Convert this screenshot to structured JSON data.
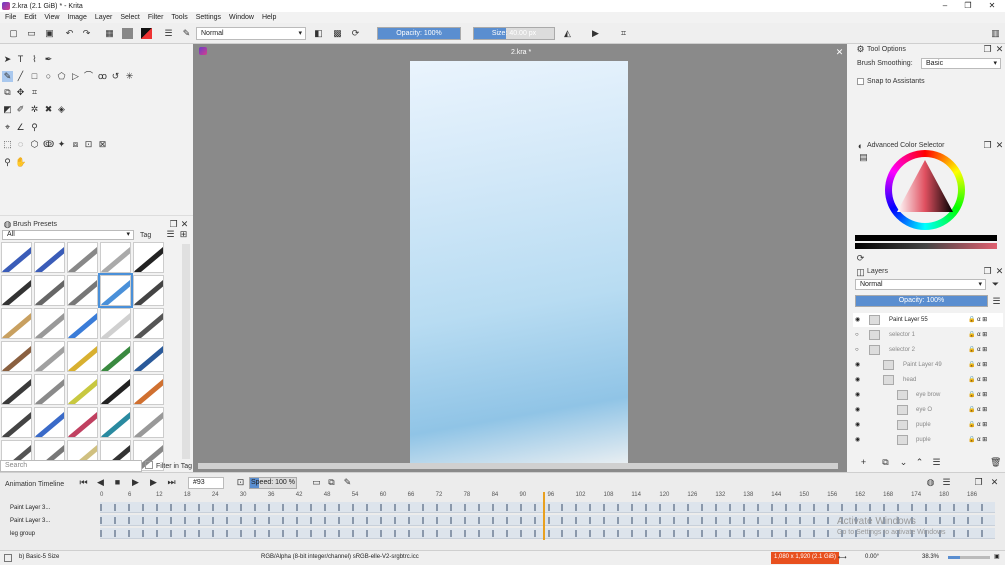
{
  "window": {
    "title": "2.kra (2.1 GiB) * - Krita",
    "min": "–",
    "max": "❐",
    "close": "✕"
  },
  "menu": [
    "File",
    "Edit",
    "View",
    "Image",
    "Layer",
    "Select",
    "Filter",
    "Tools",
    "Settings",
    "Window",
    "Help"
  ],
  "toolbar": {
    "blend_mode": "Normal",
    "opacity": "Opacity: 100%",
    "opacity_value": 1.0,
    "size": "Size: 40.00 px",
    "size_value": 40
  },
  "document_tab": "2.kra *",
  "brush_presets": {
    "title": "Brush Presets",
    "filter": "All",
    "tag": "Tag",
    "search_placeholder": "Search",
    "filter_in_tag": "Filter in Tag",
    "colors": [
      "#3a5cb8",
      "#3a5cb8",
      "#888888",
      "#aaaaaa",
      "#222222",
      "#333333",
      "#666666",
      "#777777",
      "#4a90d9",
      "#444444",
      "#c8a060",
      "#999999",
      "#3a7cd8",
      "#d0d0d0",
      "#555555",
      "#8a6040",
      "#a0a0a0",
      "#d8b030",
      "#3a8a40",
      "#2a5a9a",
      "#3a3a3a",
      "#8a8a8a",
      "#c8c840",
      "#222222",
      "#d07030",
      "#444444",
      "#3a6ac8",
      "#c04060",
      "#2a8aa0",
      "#999999",
      "#555555",
      "#777777",
      "#d0c080",
      "#333333",
      "#888888"
    ]
  },
  "tool_options": {
    "title": "Tool Options",
    "smoothing_label": "Brush Smoothing:",
    "smoothing_value": "Basic",
    "snap": "Snap to Assistants"
  },
  "color_selector": {
    "title": "Advanced Color Selector"
  },
  "layers": {
    "title": "Layers",
    "blend_mode": "Normal",
    "opacity": "Opacity: 100%",
    "rows": [
      {
        "name": "Paint Layer 55",
        "visible": true,
        "dim": false
      },
      {
        "name": "selector 1",
        "visible": false,
        "dim": true
      },
      {
        "name": "selector 2",
        "visible": false,
        "dim": true
      },
      {
        "name": "Paint Layer 49",
        "visible": true,
        "dim": true
      },
      {
        "name": "head",
        "visible": true,
        "dim": true
      },
      {
        "name": "eye brow",
        "visible": true,
        "dim": true
      },
      {
        "name": "eye O",
        "visible": true,
        "dim": true
      },
      {
        "name": "puple",
        "visible": true,
        "dim": true
      },
      {
        "name": "puple",
        "visible": true,
        "dim": true
      }
    ]
  },
  "timeline": {
    "title": "Animation Timeline",
    "frame": "93",
    "speed": "Speed: 100 %",
    "ruler": [
      "0",
      "6",
      "12",
      "18",
      "24",
      "30",
      "36",
      "42",
      "48",
      "54",
      "60",
      "66",
      "72",
      "78",
      "84",
      "90",
      "96",
      "102",
      "108",
      "114",
      "120",
      "126",
      "132",
      "138",
      "144",
      "150",
      "156",
      "162",
      "168",
      "174",
      "180",
      "186"
    ],
    "layers": [
      "Paint Layer 3...",
      "Paint Layer 3...",
      "leg group"
    ]
  },
  "activate_windows": {
    "line1": "Activate Windows",
    "line2": "Go to Settings to activate Windows"
  },
  "status": {
    "brush": "b) Basic-5 Size",
    "color_space": "RGB/Alpha (8-bit integer/channel)  sRGB-elle-V2-srgbtrc.icc",
    "image_size": "1,080 x 1,920 (2.1 GiB)",
    "rotation": "0.00°",
    "zoom": "38.3%"
  },
  "colors": {
    "accent": "#5a8ed0",
    "selection": "#4a90d9",
    "warning": "#e8501e"
  }
}
